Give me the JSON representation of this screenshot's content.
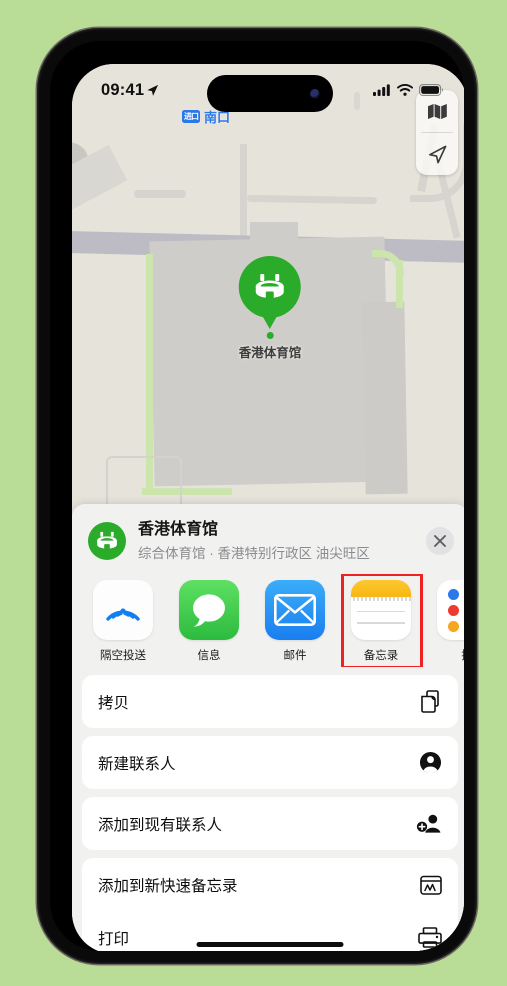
{
  "background_color": "#b9dd96",
  "status_bar": {
    "time": "09:41",
    "location_arrow_icon": "location-arrow-icon",
    "cellular_icon": "cellular-signal-icon",
    "wifi_icon": "wifi-icon",
    "battery_icon": "battery-icon"
  },
  "map": {
    "entrance_label": {
      "badge_text": "进口",
      "text": "南口",
      "color": "#2b79e8"
    },
    "pin": {
      "label": "香港体育馆",
      "color": "#2aab2a",
      "icon": "stadium-icon"
    },
    "controls": [
      {
        "name": "map-layers-button",
        "icon": "map-layers-icon"
      },
      {
        "name": "locate-me-button",
        "icon": "location-arrow-icon"
      }
    ]
  },
  "share_sheet": {
    "place": {
      "title": "香港体育馆",
      "subtitle": "综合体育馆 · 香港特别行政区 油尖旺区",
      "icon": "stadium-icon",
      "icon_color": "#2aab2a"
    },
    "close_button_label": "✕",
    "apps": [
      {
        "name": "airdrop",
        "label": "隔空投送",
        "icon": "airdrop-icon"
      },
      {
        "name": "messages",
        "label": "信息",
        "icon": "messages-bubble-icon"
      },
      {
        "name": "mail",
        "label": "邮件",
        "icon": "mail-envelope-icon"
      },
      {
        "name": "notes",
        "label": "备忘录",
        "icon": "notes-icon",
        "highlighted": true,
        "highlight_color": "#ee2222"
      },
      {
        "name": "reminders",
        "label": "提",
        "icon": "reminders-icon"
      }
    ],
    "actions": [
      {
        "name": "copy",
        "label": "拷贝",
        "icon": "copy-icon"
      },
      {
        "name": "new-contact",
        "label": "新建联系人",
        "icon": "person-circle-icon"
      },
      {
        "name": "add-to-existing-contact",
        "label": "添加到现有联系人",
        "icon": "person-add-icon"
      },
      {
        "name": "add-to-quick-note",
        "label": "添加到新快速备忘录",
        "icon": "quick-note-icon"
      },
      {
        "name": "print",
        "label": "打印",
        "icon": "printer-icon"
      }
    ]
  }
}
